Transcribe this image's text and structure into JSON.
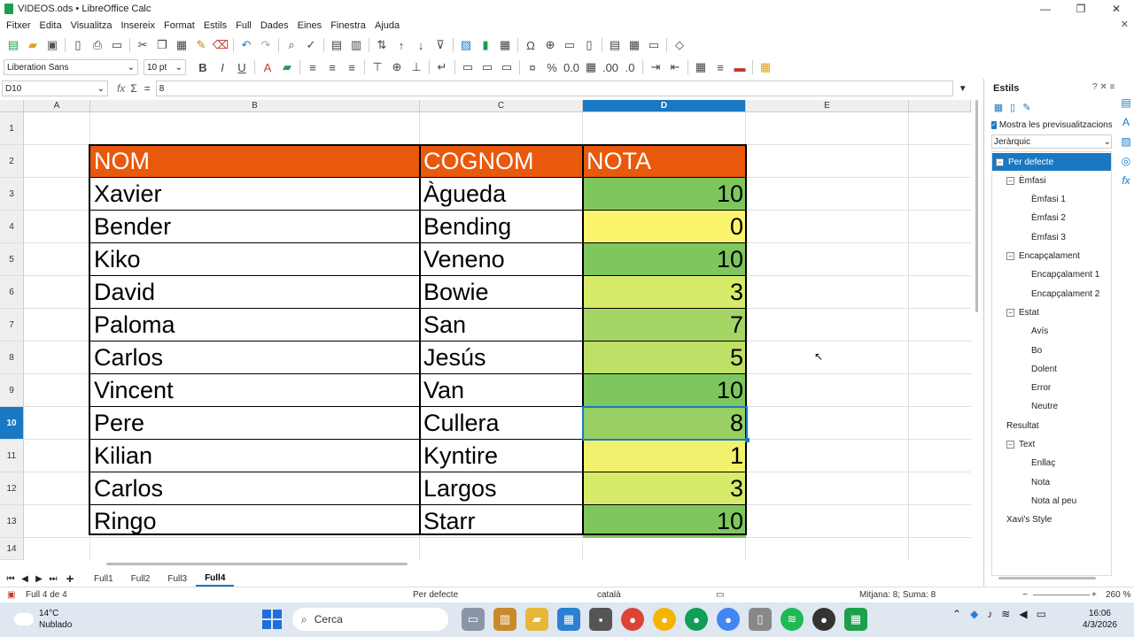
{
  "window": {
    "title": "VIDEOS.ods • LibreOffice Calc",
    "minimize": "—",
    "maximize": "❐",
    "close": "✕"
  },
  "menu": [
    "Fitxer",
    "Edita",
    "Visualitza",
    "Insereix",
    "Format",
    "Estils",
    "Full",
    "Dades",
    "Eines",
    "Finestra",
    "Ajuda"
  ],
  "menu_close": "✕",
  "toolbar2": {
    "font_name": "Liberation Sans",
    "font_size": "10 pt"
  },
  "formula": {
    "cell_ref": "D10",
    "fx": "fx",
    "sigma": "Σ",
    "eq": "=",
    "value": "8"
  },
  "columns": [
    "A",
    "B",
    "C",
    "D",
    "E"
  ],
  "rows": [
    "1",
    "2",
    "3",
    "4",
    "5",
    "6",
    "7",
    "8",
    "9",
    "10",
    "11",
    "12",
    "13",
    "14"
  ],
  "table": {
    "headers": [
      "NOM",
      "COGNOM",
      "NOTA"
    ],
    "rows": [
      {
        "nom": "Xavier",
        "cognom": "Àgueda",
        "nota": "10",
        "color": "#7ec75f"
      },
      {
        "nom": "Bender",
        "cognom": "Bending",
        "nota": "0",
        "color": "#fbf56e"
      },
      {
        "nom": "Kiko",
        "cognom": "Veneno",
        "nota": "10",
        "color": "#7ec75f"
      },
      {
        "nom": "David",
        "cognom": "Bowie",
        "nota": "3",
        "color": "#d7ea6a"
      },
      {
        "nom": "Paloma",
        "cognom": "San",
        "nota": "7",
        "color": "#a4d565"
      },
      {
        "nom": "Carlos",
        "cognom": "Jesús",
        "nota": "5",
        "color": "#bfe067"
      },
      {
        "nom": "Vincent",
        "cognom": "Van",
        "nota": "10",
        "color": "#7ec75f"
      },
      {
        "nom": "Pere",
        "cognom": "Cullera",
        "nota": "8",
        "color": "#98d063"
      },
      {
        "nom": "Kilian",
        "cognom": "Kyntire",
        "nota": "1",
        "color": "#f1f16d"
      },
      {
        "nom": "Carlos",
        "cognom": "Largos",
        "nota": "3",
        "color": "#d7ea6a"
      },
      {
        "nom": "Ringo",
        "cognom": "Starr",
        "nota": "10",
        "color": "#7ec75f"
      }
    ]
  },
  "sheets": [
    "Full1",
    "Full2",
    "Full3",
    "Full4"
  ],
  "active_sheet": "Full4",
  "status": {
    "sheet": "Full 4 de 4",
    "style": "Per defecte",
    "lang": "català",
    "stats": "Mitjana: 8; Suma: 8",
    "zoom": "260 %"
  },
  "sidebar": {
    "title": "Estils",
    "preview_label": "Mostra les previsualitzacions",
    "filter": "Jeràrquic",
    "items": [
      {
        "label": "Per defecte",
        "level": 0,
        "toggle": "−",
        "selected": true
      },
      {
        "label": "Èmfasi",
        "level": 1,
        "toggle": "−"
      },
      {
        "label": "Èmfasi 1",
        "level": 2
      },
      {
        "label": "Èmfasi 2",
        "level": 2
      },
      {
        "label": "Èmfasi 3",
        "level": 2
      },
      {
        "label": "Encapçalament",
        "level": 1,
        "toggle": "−"
      },
      {
        "label": "Encapçalament 1",
        "level": 2
      },
      {
        "label": "Encapçalament 2",
        "level": 2
      },
      {
        "label": "Estat",
        "level": 1,
        "toggle": "−"
      },
      {
        "label": "Avís",
        "level": 2
      },
      {
        "label": "Bo",
        "level": 2
      },
      {
        "label": "Dolent",
        "level": 2
      },
      {
        "label": "Error",
        "level": 2
      },
      {
        "label": "Neutre",
        "level": 2
      },
      {
        "label": "Resultat",
        "level": 1
      },
      {
        "label": "Text",
        "level": 1,
        "toggle": "−"
      },
      {
        "label": "Enllaç",
        "level": 2
      },
      {
        "label": "Nota",
        "level": 2
      },
      {
        "label": "Nota al peu",
        "level": 2
      },
      {
        "label": "Xavi's Style",
        "level": 1
      }
    ]
  },
  "taskbar": {
    "temp": "14°C",
    "weather": "Nublado",
    "search": "Cerca",
    "time": "16:06",
    "date": "4/3/2026"
  },
  "colors": {
    "accent": "#1a78c2",
    "header_fill": "#e8590c"
  }
}
